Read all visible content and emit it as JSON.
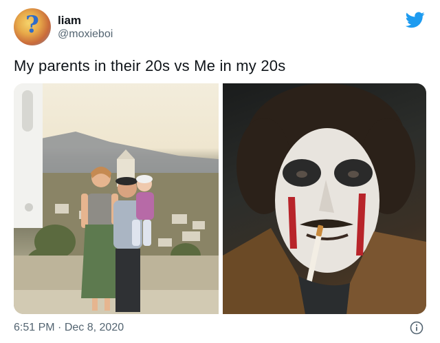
{
  "tweet": {
    "author_name": "liam",
    "author_handle": "@moxieboi",
    "text": "My parents in their 20s vs Me in my 20s",
    "time": "6:51 PM",
    "separator": "·",
    "date": "Dec 8, 2020"
  },
  "icons": {
    "brand": "twitter-bird-icon",
    "info": "info-icon"
  },
  "colors": {
    "twitter_blue": "#1d9bf0",
    "secondary_text": "#536471",
    "primary_text": "#0f1419"
  }
}
